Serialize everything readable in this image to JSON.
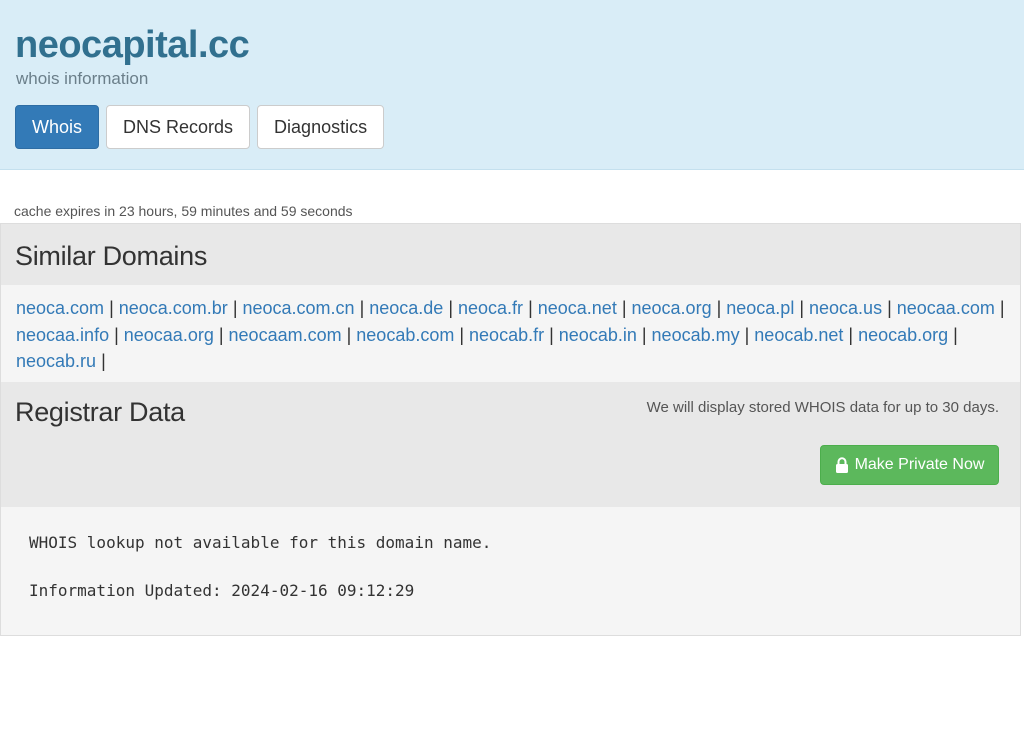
{
  "header": {
    "title": "neocapital.cc",
    "subtitle": "whois information",
    "tabs": [
      {
        "label": "Whois",
        "active": true
      },
      {
        "label": "DNS Records",
        "active": false
      },
      {
        "label": "Diagnostics",
        "active": false
      }
    ]
  },
  "cache_note": "cache expires in 23 hours, 59 minutes and 59 seconds",
  "similar": {
    "title": "Similar Domains",
    "domains": [
      "neoca.com",
      "neoca.com.br",
      "neoca.com.cn",
      "neoca.de",
      "neoca.fr",
      "neoca.net",
      "neoca.org",
      "neoca.pl",
      "neoca.us",
      "neocaa.com",
      "neocaa.info",
      "neocaa.org",
      "neocaam.com",
      "neocab.com",
      "neocab.fr",
      "neocab.in",
      "neocab.my",
      "neocab.net",
      "neocab.org",
      "neocab.ru"
    ]
  },
  "registrar": {
    "title": "Registrar Data",
    "note": "We will display stored WHOIS data for up to 30 days.",
    "button_label": "Make Private Now",
    "button_icon": "lock-icon",
    "button_color": "#5cb85c"
  },
  "whois": {
    "line1": "WHOIS lookup not available for this domain name.",
    "line2": "",
    "line3": "Information Updated: 2024-02-16 09:12:29"
  },
  "colors": {
    "header_bg": "#d9edf7",
    "title": "#31708f",
    "link": "#337ab7",
    "active_tab": "#337ab7"
  }
}
